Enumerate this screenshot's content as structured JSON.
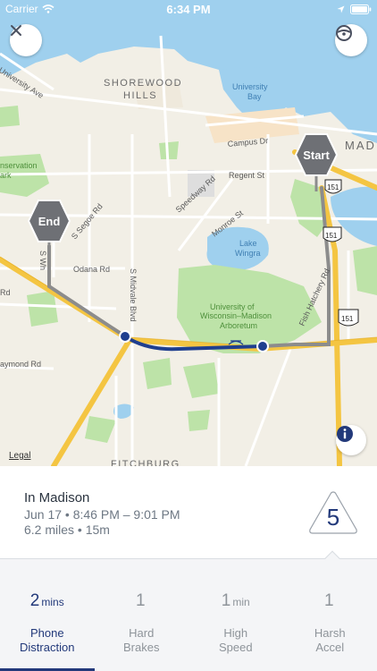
{
  "status_bar": {
    "carrier": "Carrier",
    "time": "6:34 PM"
  },
  "map": {
    "labels": {
      "university_ave": "University Ave",
      "shorewood_1": "SHOREWOOD",
      "shorewood_2": "HILLS",
      "university_bay_1": "University",
      "university_bay_2": "Bay",
      "campus_dr": "Campus Dr",
      "mad": "MAD",
      "conservation_1": "nservation",
      "conservation_2": "ark",
      "regent_st": "Regent St",
      "speedway_rd": "Speedway Rd",
      "monroe_st": "Monroe St",
      "s_segoe_rd": "S Segoe Rd",
      "odana_rd": "Odana Rd",
      "s_midvale_blvd": "S Midvale Blvd",
      "lake_wingra_1": "Lake",
      "lake_wingra_2": "Wingra",
      "arboretum_1": "University of",
      "arboretum_2": "Wisconsin–Madison",
      "arboretum_3": "Arboretum",
      "fish_hatchery_rd": "Fish Hatchery Rd",
      "s_whitney": "S Wh",
      "raymond_rd": "aymond Rd",
      "legal": "Legal",
      "fitchburg": "FITCHBURG",
      "route_151_a": "151",
      "route_151_b": "151",
      "route_151_c": "151",
      "rd_edge_left": "Rd"
    },
    "start_label": "Start",
    "end_label": "End",
    "route_color": "#1f3f8f",
    "highway_color": "#f4c542"
  },
  "trip": {
    "title": "In Madison",
    "date_range": "Jun 17 • 8:46 PM – 9:01 PM",
    "distance_duration": "6.2 miles • 15m",
    "score": "5"
  },
  "stats": [
    {
      "value": "2",
      "unit": "mins",
      "label_1": "Phone",
      "label_2": "Distraction",
      "active": true
    },
    {
      "value": "1",
      "unit": "",
      "label_1": "Hard",
      "label_2": "Brakes",
      "active": false
    },
    {
      "value": "1",
      "unit": "min",
      "label_1": "High",
      "label_2": "Speed",
      "active": false
    },
    {
      "value": "1",
      "unit": "",
      "label_1": "Harsh",
      "label_2": "Accel",
      "active": false
    }
  ]
}
